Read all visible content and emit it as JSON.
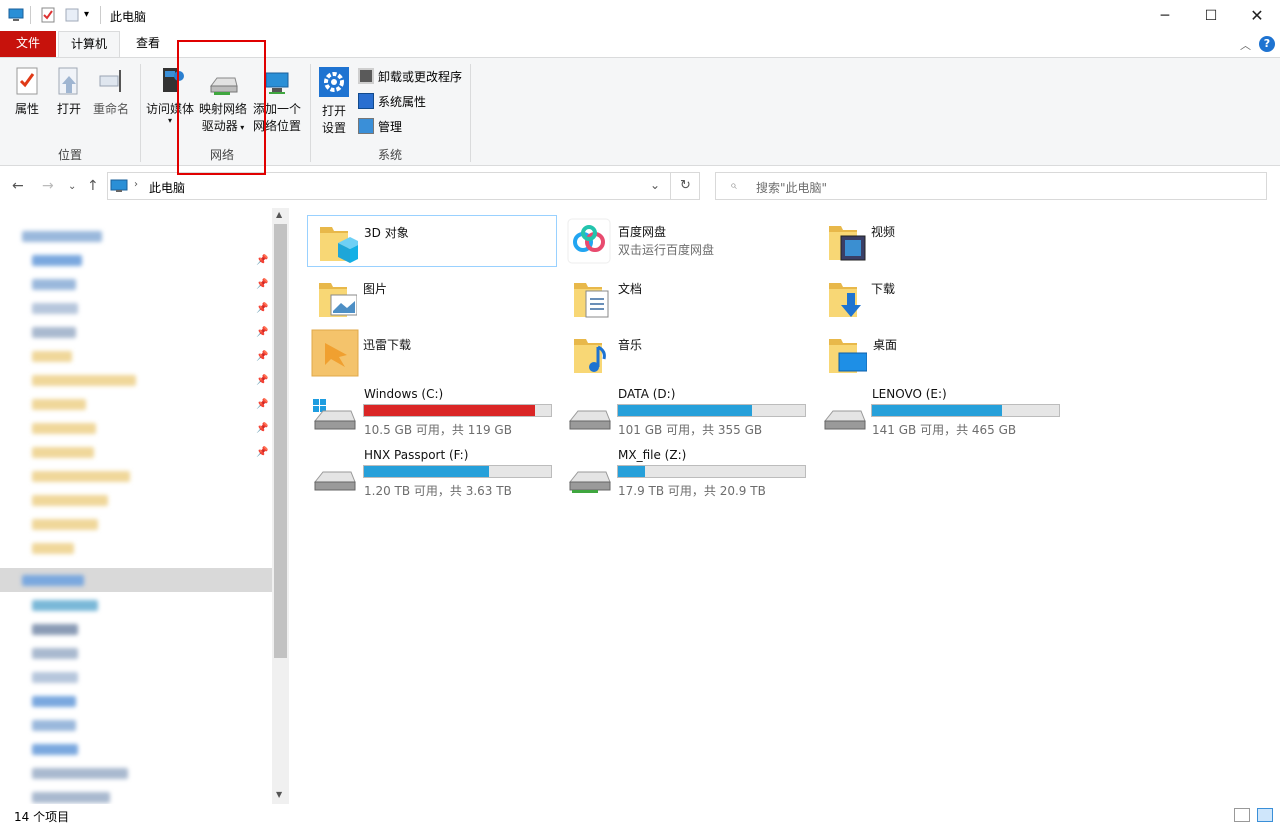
{
  "window": {
    "title": "此电脑"
  },
  "tabs": {
    "file": "文件",
    "computer": "计算机",
    "view": "查看"
  },
  "ribbon": {
    "location": {
      "group_label": "位置",
      "properties": "属性",
      "open": "打开",
      "rename": "重命名"
    },
    "network": {
      "group_label": "网络",
      "access_media": "访问媒体",
      "map_drive_line1": "映射网络",
      "map_drive_line2": "驱动器",
      "add_location_line1": "添加一个",
      "add_location_line2": "网络位置"
    },
    "system": {
      "group_label": "系统",
      "open_settings_line1": "打开",
      "open_settings_line2": "设置",
      "uninstall": "卸载或更改程序",
      "system_properties": "系统属性",
      "manage": "管理"
    }
  },
  "address": {
    "path": "此电脑",
    "search_placeholder": "搜索\"此电脑\""
  },
  "folders": [
    {
      "name": "3D 对象",
      "sub": ""
    },
    {
      "name": "百度网盘",
      "sub": "双击运行百度网盘"
    },
    {
      "name": "视频",
      "sub": ""
    },
    {
      "name": "图片",
      "sub": ""
    },
    {
      "name": "文档",
      "sub": ""
    },
    {
      "name": "下载",
      "sub": ""
    },
    {
      "name": "迅雷下载",
      "sub": ""
    },
    {
      "name": "音乐",
      "sub": ""
    },
    {
      "name": "桌面",
      "sub": ""
    }
  ],
  "drives": [
    {
      "name": "Windows (C:)",
      "info": "10.5 GB 可用，共 119 GB",
      "used_fraction": 0.912,
      "color": "#da2626"
    },
    {
      "name": "DATA (D:)",
      "info": "101 GB 可用，共 355 GB",
      "used_fraction": 0.716,
      "color": "#26a0da"
    },
    {
      "name": "LENOVO (E:)",
      "info": "141 GB 可用，共 465 GB",
      "used_fraction": 0.697,
      "color": "#26a0da"
    },
    {
      "name": "HNX Passport (F:)",
      "info": "1.20 TB 可用，共 3.63 TB",
      "used_fraction": 0.669,
      "color": "#26a0da"
    },
    {
      "name": "MX_file (Z:)",
      "info": "17.9 TB 可用，共 20.9 TB",
      "used_fraction": 0.144,
      "color": "#26a0da"
    }
  ],
  "status": {
    "count": "14 个项目"
  }
}
